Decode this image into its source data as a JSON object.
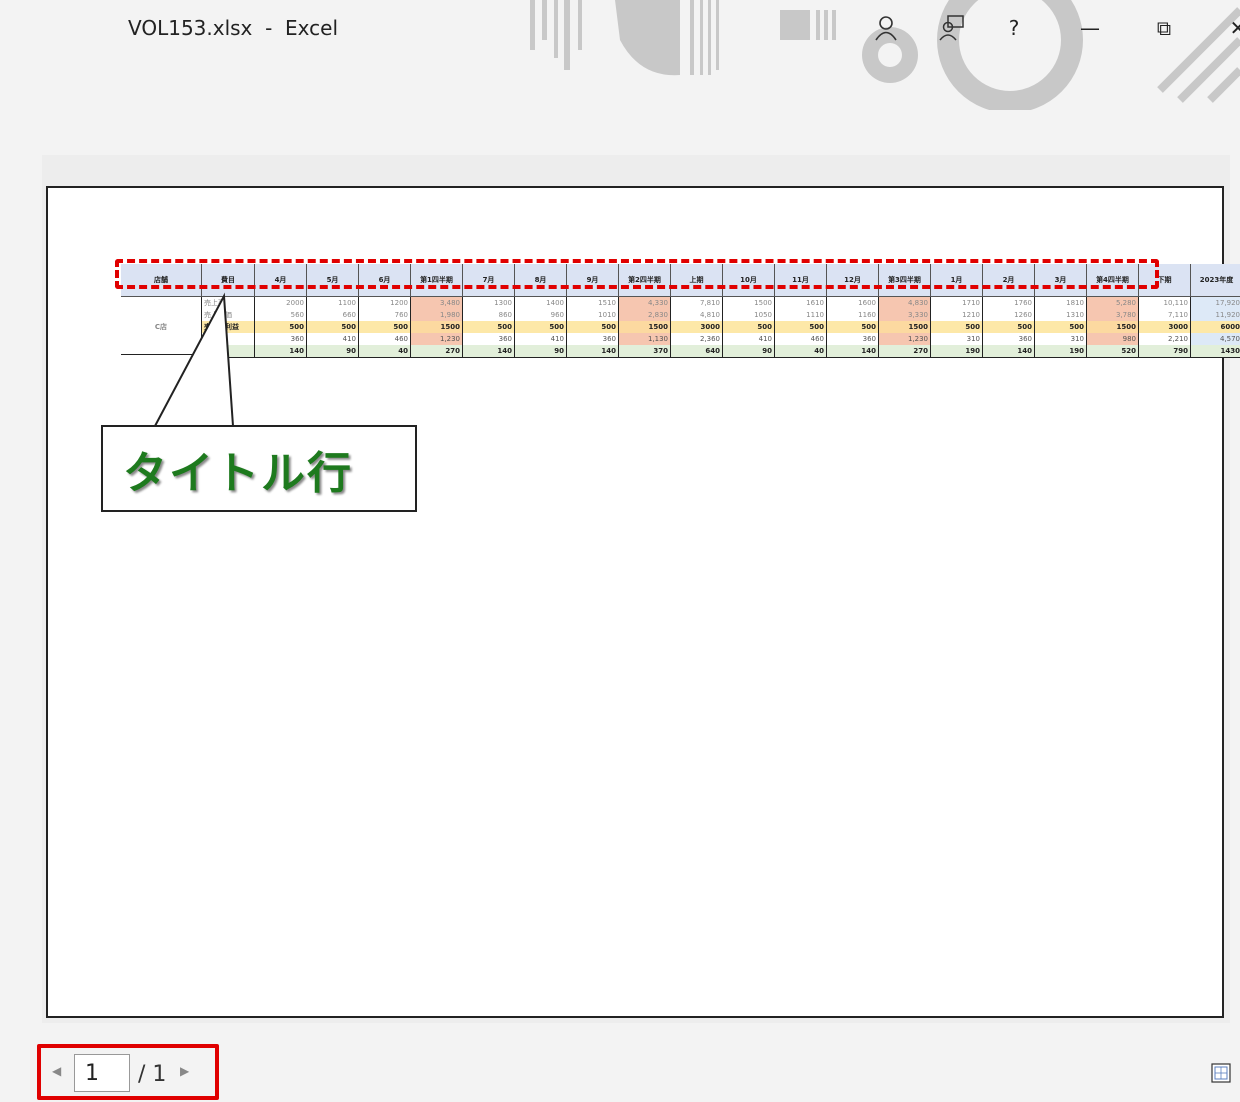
{
  "window": {
    "title": "VOL153.xlsx  -  Excel"
  },
  "titlebar_buttons": {
    "account_icon": "person-icon",
    "comments_icon": "comments-icon",
    "help": "?",
    "minimize": "—",
    "restore": "⧉",
    "close": "✕"
  },
  "sheet": {
    "headers": [
      "店舗",
      "費目",
      "4月",
      "5月",
      "6月",
      "第1四半期",
      "7月",
      "8月",
      "9月",
      "第2四半期",
      "上期",
      "10月",
      "11月",
      "12月",
      "第3四半期",
      "1月",
      "2月",
      "3月",
      "第4四半期",
      "下期",
      "2023年度"
    ],
    "store": "C店",
    "rows": [
      {
        "item": "売上高",
        "values": [
          "2000",
          "1100",
          "1200",
          "3,480",
          "1300",
          "1400",
          "1510",
          "4,330",
          "7,810",
          "1500",
          "1610",
          "1600",
          "4,830",
          "1710",
          "1760",
          "1810",
          "5,280",
          "10,110",
          "17,920"
        ]
      },
      {
        "item": "売上原価",
        "values": [
          "560",
          "660",
          "760",
          "1,980",
          "860",
          "960",
          "1010",
          "2,830",
          "4,810",
          "1050",
          "1110",
          "1160",
          "3,330",
          "1210",
          "1260",
          "1310",
          "3,780",
          "7,110",
          "11,920"
        ]
      },
      {
        "item": "売上総利益",
        "values": [
          "500",
          "500",
          "500",
          "1500",
          "500",
          "500",
          "500",
          "1500",
          "3000",
          "500",
          "500",
          "500",
          "1500",
          "500",
          "500",
          "500",
          "1500",
          "3000",
          "6000"
        ]
      },
      {
        "item": "",
        "values": [
          "360",
          "410",
          "460",
          "1,230",
          "360",
          "410",
          "360",
          "1,130",
          "2,360",
          "410",
          "460",
          "360",
          "1,230",
          "310",
          "360",
          "310",
          "980",
          "2,210",
          "4,570"
        ]
      },
      {
        "item": "",
        "values": [
          "140",
          "90",
          "40",
          "270",
          "140",
          "90",
          "140",
          "370",
          "640",
          "90",
          "40",
          "140",
          "270",
          "190",
          "140",
          "190",
          "520",
          "790",
          "1430"
        ]
      }
    ]
  },
  "callout": {
    "text": "タイトル行"
  },
  "pager": {
    "current": "1",
    "total": "/ 1"
  },
  "colors": {
    "highlight_red": "#e00000",
    "callout_green": "#1e7a1e",
    "header_blue": "#dbe3f3"
  }
}
